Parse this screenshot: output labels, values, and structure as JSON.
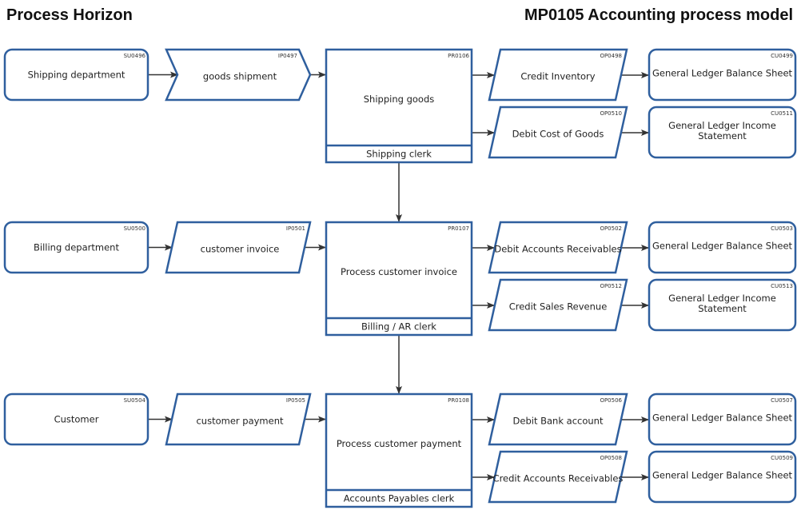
{
  "header": {
    "left_title": "Process Horizon",
    "right_title": "MP0105 Accounting process model"
  },
  "colors": {
    "shape_border": "#2f5f9e",
    "connector": "#333333"
  },
  "rows": [
    {
      "supplier": {
        "code": "SU0496",
        "label": "Shipping department"
      },
      "input": {
        "code": "IP0497",
        "label": "goods shipment",
        "shape": "chevron"
      },
      "process": {
        "code": "PR0106",
        "label": "Shipping goods",
        "role": "Shipping clerk"
      },
      "outputs": [
        {
          "code": "OP0498",
          "label": "Credit Inventory",
          "customer": {
            "code": "CU0499",
            "label": [
              "General Ledger Balance Sheet"
            ]
          }
        },
        {
          "code": "OP0510",
          "label": "Debit Cost of Goods",
          "customer": {
            "code": "CU0511",
            "label": [
              "General Ledger Income",
              "Statement"
            ]
          }
        }
      ]
    },
    {
      "supplier": {
        "code": "SU0500",
        "label": "Billing department"
      },
      "input": {
        "code": "IP0501",
        "label": "customer invoice",
        "shape": "parallelogram"
      },
      "process": {
        "code": "PR0107",
        "label": "Process customer invoice",
        "role": "Billing / AR clerk"
      },
      "outputs": [
        {
          "code": "OP0502",
          "label": "Debit Accounts Receivables",
          "customer": {
            "code": "CU0503",
            "label": [
              "General Ledger Balance Sheet"
            ]
          }
        },
        {
          "code": "OP0512",
          "label": "Credit Sales Revenue",
          "customer": {
            "code": "CU0513",
            "label": [
              "General Ledger Income",
              "Statement"
            ]
          }
        }
      ]
    },
    {
      "supplier": {
        "code": "SU0504",
        "label": "Customer"
      },
      "input": {
        "code": "IP0505",
        "label": "customer payment",
        "shape": "parallelogram"
      },
      "process": {
        "code": "PR0108",
        "label": "Process customer payment",
        "role": "Accounts Payables clerk"
      },
      "outputs": [
        {
          "code": "OP0506",
          "label": "Debit Bank account",
          "customer": {
            "code": "CU0507",
            "label": [
              "General Ledger Balance Sheet"
            ]
          }
        },
        {
          "code": "OP0508",
          "label": "Credit Accounts Receivables",
          "customer": {
            "code": "CU0509",
            "label": [
              "General Ledger Balance Sheet"
            ]
          }
        }
      ]
    }
  ]
}
